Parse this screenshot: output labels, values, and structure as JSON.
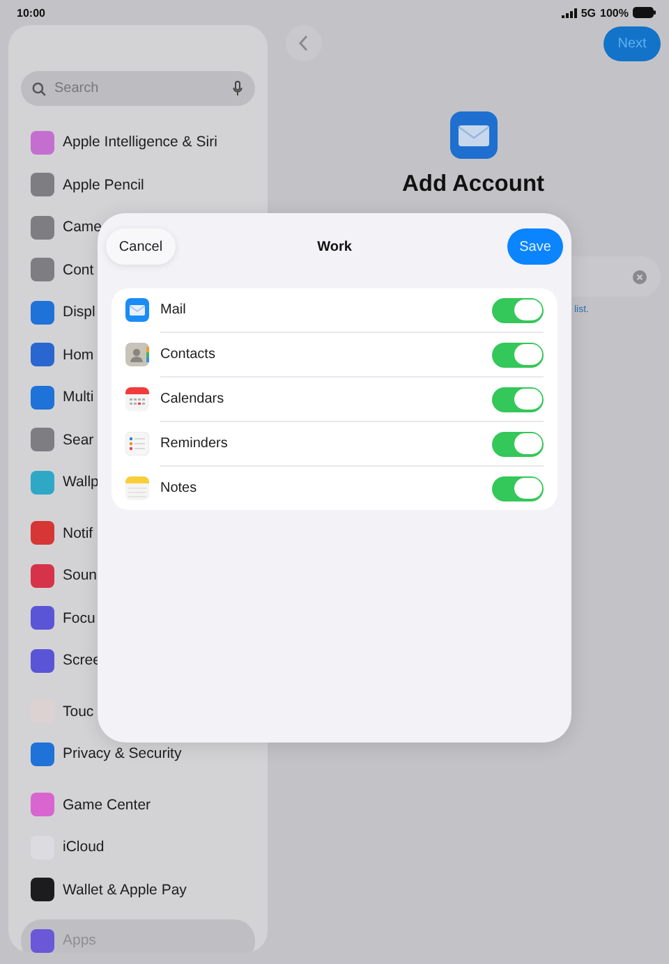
{
  "status_bar": {
    "time": "10:00",
    "network": "5G",
    "battery": "100%"
  },
  "sidebar": {
    "search": {
      "placeholder": "Search"
    },
    "groups": [
      {
        "items": [
          {
            "label": "Apple Intelligence & Siri",
            "color": "#c46fd0",
            "selected": false
          },
          {
            "label": "Apple Pencil",
            "color": "#7d7d82",
            "selected": false
          },
          {
            "label": "Came",
            "color": "#7d7d82",
            "selected": false
          },
          {
            "label": "Cont",
            "color": "#7d7d82",
            "selected": false
          },
          {
            "label": "Displ",
            "color": "#1f72d8",
            "selected": false
          },
          {
            "label": "Hom",
            "color": "#2a66d0",
            "selected": false
          },
          {
            "label": "Multi",
            "color": "#1f72d8",
            "selected": false
          },
          {
            "label": "Sear",
            "color": "#7d7d82",
            "selected": false
          },
          {
            "label": "Wallp",
            "color": "#2fa8c6",
            "selected": false
          }
        ]
      },
      {
        "items": [
          {
            "label": "Notif",
            "color": "#d63636",
            "selected": false
          },
          {
            "label": "Soun",
            "color": "#d6334a",
            "selected": false
          },
          {
            "label": "Focu",
            "color": "#5a55d6",
            "selected": false
          },
          {
            "label": "Scree",
            "color": "#5a55d6",
            "selected": false
          }
        ]
      },
      {
        "items": [
          {
            "label": "Touc",
            "color": "#dcd2d2",
            "selected": false
          },
          {
            "label": "Privacy & Security",
            "color": "#1f72d8",
            "selected": false
          }
        ]
      },
      {
        "items": [
          {
            "label": "Game Center",
            "color": "#d865d0",
            "selected": false
          },
          {
            "label": "iCloud",
            "color": "#dcdce0",
            "selected": false
          },
          {
            "label": "Wallet & Apple Pay",
            "color": "#1c1c1e",
            "selected": false
          }
        ]
      },
      {
        "items": [
          {
            "label": "Apps",
            "color": "#6a58d8",
            "selected": true
          }
        ]
      }
    ]
  },
  "detail": {
    "next_button": "Next",
    "title": "Add Account",
    "footnote": "list."
  },
  "sheet": {
    "cancel_button": "Cancel",
    "title": "Work",
    "save_button": "Save",
    "services": [
      {
        "label": "Mail",
        "on": true
      },
      {
        "label": "Contacts",
        "on": true
      },
      {
        "label": "Calendars",
        "on": true
      },
      {
        "label": "Reminders",
        "on": true
      },
      {
        "label": "Notes",
        "on": true
      }
    ]
  }
}
